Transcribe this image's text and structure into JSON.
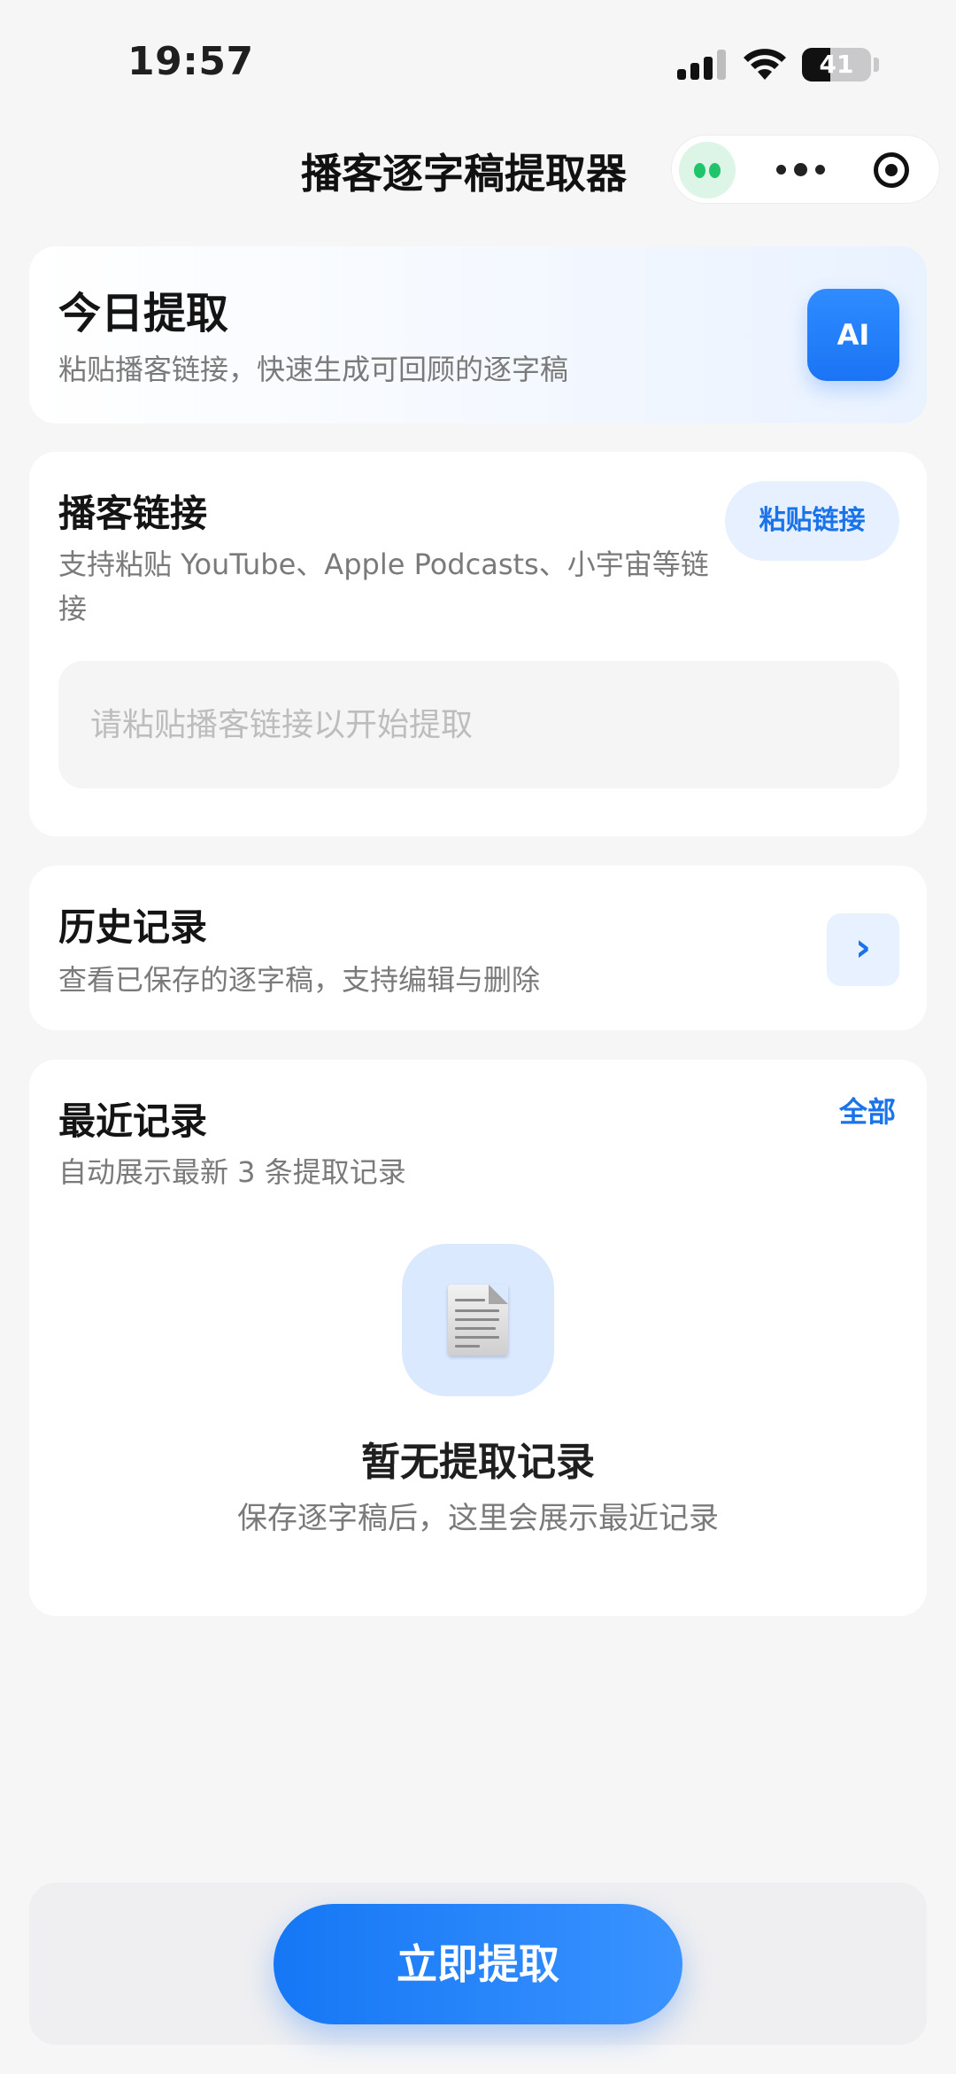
{
  "status_bar": {
    "time": "19:57",
    "battery": "41",
    "battery_level_percent": 41
  },
  "nav": {
    "title": "播客逐字稿提取器"
  },
  "today": {
    "title": "今日提取",
    "subtitle": "粘贴播客链接，快速生成可回顾的逐字稿",
    "badge": "AI"
  },
  "link": {
    "title": "播客链接",
    "subtitle_line1": "支持粘贴 YouTube、Apple Podcasts、小宇宙等链",
    "subtitle_line2": "接",
    "paste_button": "粘贴链接",
    "input_value": "",
    "input_placeholder": "请粘贴播客链接以开始提取"
  },
  "history": {
    "title": "历史记录",
    "subtitle": "查看已保存的逐字稿，支持编辑与删除",
    "arrow": "›"
  },
  "recent": {
    "title": "最近记录",
    "subtitle": "自动展示最新 3 条提取记录",
    "all_link": "全部",
    "empty_title": "暂无提取记录",
    "empty_subtitle": "保存逐字稿后，这里会展示最近记录"
  },
  "actions": {
    "primary": "立即提取"
  },
  "colors": {
    "accent": "#1a73e8",
    "primary_button": "#1577f5",
    "mini_program_green": "#1fc46b",
    "background": "#f6f6f7"
  },
  "icons": {
    "signal": "cellular-signal-icon",
    "wifi": "wifi-icon",
    "battery": "battery-icon",
    "more": "more-dots-icon",
    "close": "target-close-icon",
    "avatar": "mini-program-avatar-icon",
    "document": "document-icon",
    "arrow": "chevron-right-icon"
  }
}
